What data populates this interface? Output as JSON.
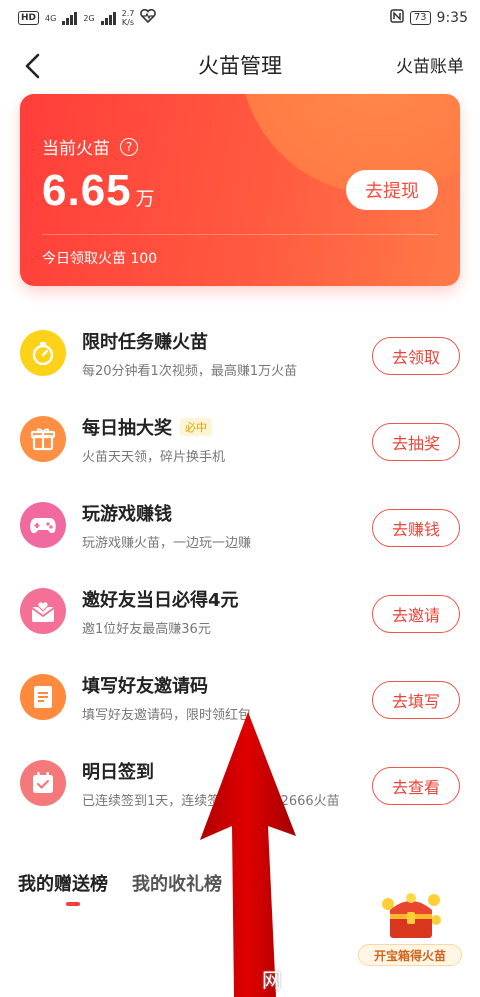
{
  "status_bar": {
    "hd_badge": "HD",
    "net_1": "4G",
    "net_2": "2G",
    "speed_value": "2.7",
    "speed_unit": "K/s",
    "battery": "73",
    "time": "9:35"
  },
  "header": {
    "title": "火苗管理",
    "right_link": "火苗账单"
  },
  "balance": {
    "label": "当前火苗",
    "help_glyph": "?",
    "amount": "6.65",
    "unit": "万",
    "withdraw_label": "去提现",
    "today": "今日领取火苗 100"
  },
  "tasks": [
    {
      "title": "限时任务赚火苗",
      "subtitle": "每20分钟看1次视频，最高赚1万火苗",
      "button": "去领取",
      "icon": "stopwatch-icon",
      "color": "#ffcc00"
    },
    {
      "title": "每日抽大奖",
      "tag": "必中",
      "subtitle": "火苗天天领，碎片换手机",
      "button": "去抽奖",
      "icon": "gift-icon",
      "color": "#ff8a3d"
    },
    {
      "title": "玩游戏赚钱",
      "subtitle": "玩游戏赚火苗，一边玩一边赚",
      "button": "去赚钱",
      "icon": "gamepad-icon",
      "color": "#f0629a"
    },
    {
      "title": "邀好友当日必得4元",
      "subtitle": "邀1位好友最高赚36元",
      "button": "去邀请",
      "icon": "envelope-icon",
      "color": "#f26a8f"
    },
    {
      "title": "填写好友邀请码",
      "subtitle": "填写好友邀请码，限时领红包",
      "button": "去填写",
      "icon": "document-icon",
      "color": "#ff8a3d"
    },
    {
      "title": "明日签到",
      "subtitle": "已连续签到1天，连续签到7天可得2666火苗",
      "button": "去查看",
      "icon": "calendar-icon",
      "color": "#f5777a"
    }
  ],
  "ranking": {
    "tab_sent": "我的赠送榜",
    "tab_received": "我的收礼榜"
  },
  "treasure": {
    "label": "开宝箱得火苗"
  },
  "watermark": "网"
}
